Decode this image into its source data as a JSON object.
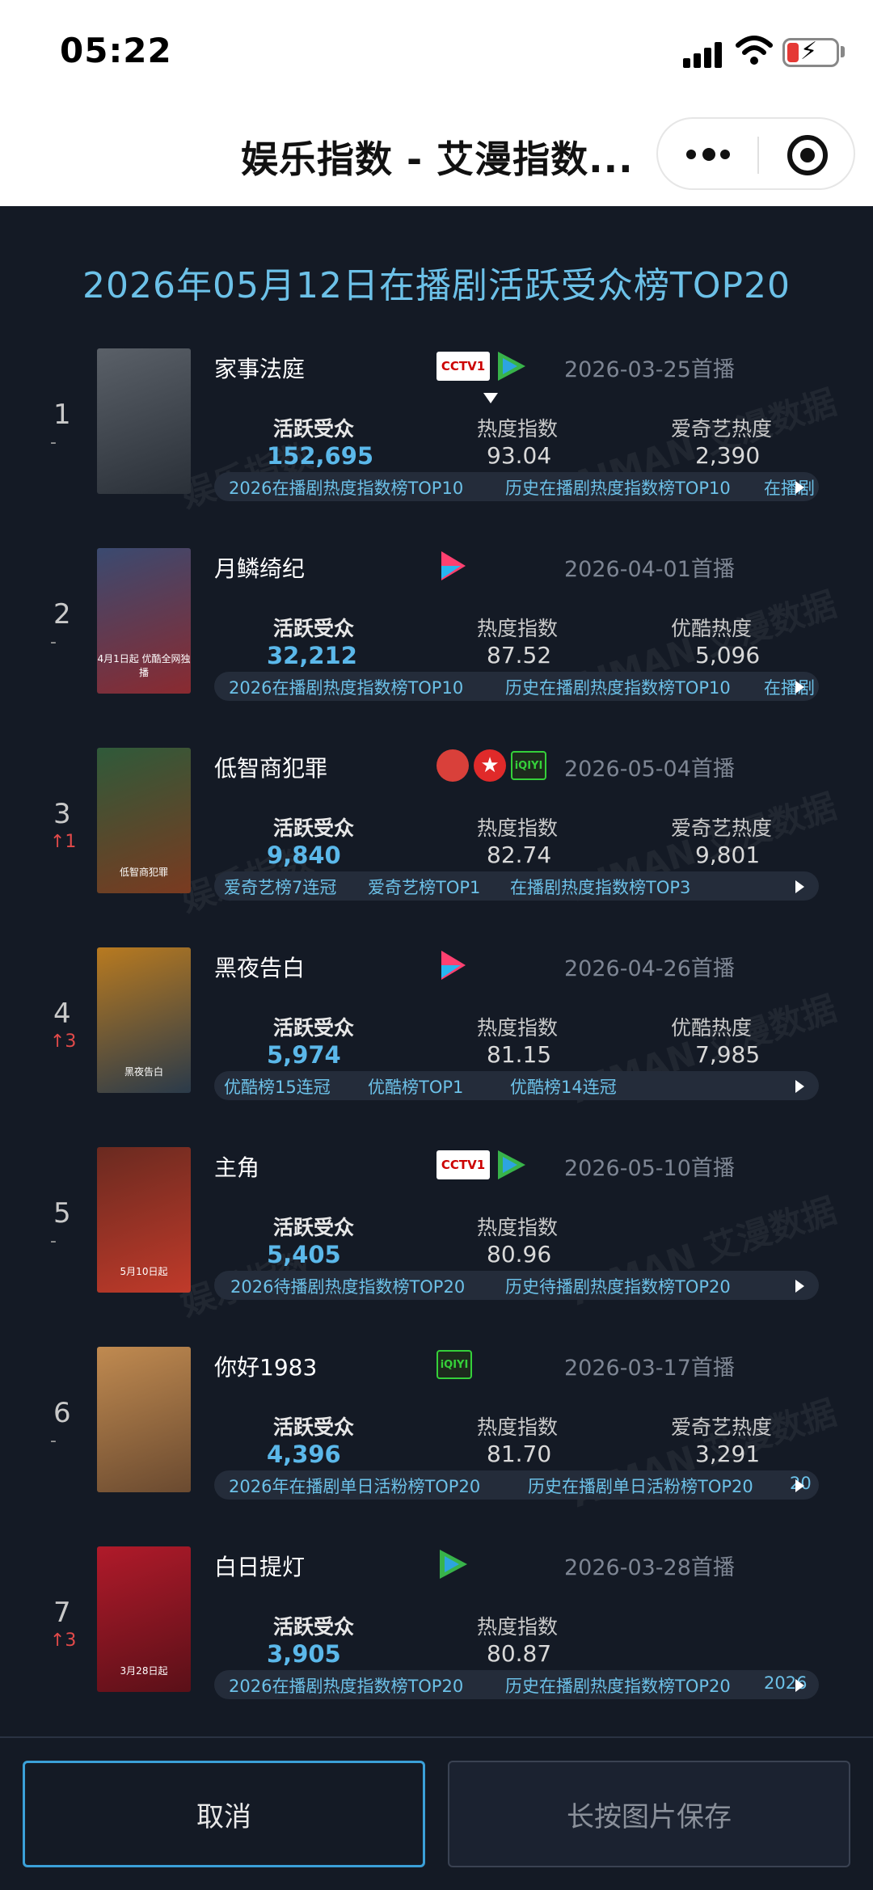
{
  "status_bar": {
    "time": "05:22"
  },
  "nav": {
    "title": "娱乐指数 - 艾漫指数..."
  },
  "chart_title": "2026年05月12日在播剧活跃受众榜TOP20",
  "watermarks": [
    "AIMAN 艾漫数据",
    "娱乐指数"
  ],
  "shows": [
    {
      "rank": "1",
      "change": "-",
      "name": "家事法庭",
      "platforms": [
        "cctv",
        "tencent"
      ],
      "premiere": "2026-03-25首播",
      "audience_label": "活跃受众",
      "audience": "152,695",
      "heat_label": "热度指数",
      "heat": "93.04",
      "platform_heat_label": "爱奇艺热度",
      "platform_heat": "2,390",
      "tags": [
        "2026在播剧热度指数榜TOP10",
        "历史在播剧热度指数榜TOP10",
        "在播剧"
      ],
      "poster_colors": [
        "#5a6068",
        "#2a3038"
      ]
    },
    {
      "rank": "2",
      "change": "-",
      "name": "月鳞绮纪",
      "platforms": [
        "youku"
      ],
      "premiere": "2026-04-01首播",
      "audience_label": "活跃受众",
      "audience": "32,212",
      "heat_label": "热度指数",
      "heat": "87.52",
      "platform_heat_label": "优酷热度",
      "platform_heat": "5,096",
      "tags": [
        "2026在播剧热度指数榜TOP10",
        "历史在播剧热度指数榜TOP10",
        "在播剧"
      ],
      "poster_colors": [
        "#3a4a70",
        "#8a2a30"
      ],
      "poster_text": "4月1日起 优酷全网独播"
    },
    {
      "rank": "3",
      "change": "↑1",
      "name": "低智商犯罪",
      "platforms": [
        "mango",
        "star",
        "iqiyi"
      ],
      "premiere": "2026-05-04首播",
      "audience_label": "活跃受众",
      "audience": "9,840",
      "heat_label": "热度指数",
      "heat": "82.74",
      "platform_heat_label": "爱奇艺热度",
      "platform_heat": "9,801",
      "tags": [
        "爱奇艺榜7连冠",
        "爱奇艺榜TOP1",
        "在播剧热度指数榜TOP3"
      ],
      "poster_colors": [
        "#2f5a3a",
        "#7a3a20"
      ],
      "poster_text": "低智商犯罪"
    },
    {
      "rank": "4",
      "change": "↑3",
      "name": "黑夜告白",
      "platforms": [
        "youku"
      ],
      "premiere": "2026-04-26首播",
      "audience_label": "活跃受众",
      "audience": "5,974",
      "heat_label": "热度指数",
      "heat": "81.15",
      "platform_heat_label": "优酷热度",
      "platform_heat": "7,985",
      "tags": [
        "优酷榜15连冠",
        "优酷榜TOP1",
        "优酷榜14连冠"
      ],
      "poster_colors": [
        "#b87a20",
        "#2a3a4a"
      ],
      "poster_text": "黑夜告白"
    },
    {
      "rank": "5",
      "change": "-",
      "name": "主角",
      "platforms": [
        "cctv",
        "tencent"
      ],
      "premiere": "2026-05-10首播",
      "audience_label": "活跃受众",
      "audience": "5,405",
      "heat_label": "热度指数",
      "heat": "80.96",
      "platform_heat_label": "",
      "platform_heat": "",
      "tags": [
        "2026待播剧热度指数榜TOP20",
        "历史待播剧热度指数榜TOP20"
      ],
      "poster_colors": [
        "#6a2a20",
        "#c03a2a"
      ],
      "poster_text": "5月10日起"
    },
    {
      "rank": "6",
      "change": "-",
      "name": "你好1983",
      "platforms": [
        "iqiyi"
      ],
      "premiere": "2026-03-17首播",
      "audience_label": "活跃受众",
      "audience": "4,396",
      "heat_label": "热度指数",
      "heat": "81.70",
      "platform_heat_label": "爱奇艺热度",
      "platform_heat": "3,291",
      "tags": [
        "2026年在播剧单日活粉榜TOP20",
        "历史在播剧单日活粉榜TOP20",
        "20"
      ],
      "poster_colors": [
        "#c08a50",
        "#6a4a30"
      ]
    },
    {
      "rank": "7",
      "change": "↑3",
      "name": "白日提灯",
      "platforms": [
        "tencent"
      ],
      "premiere": "2026-03-28首播",
      "audience_label": "活跃受众",
      "audience": "3,905",
      "heat_label": "热度指数",
      "heat": "80.87",
      "platform_heat_label": "",
      "platform_heat": "",
      "tags": [
        "2026在播剧热度指数榜TOP20",
        "历史在播剧热度指数榜TOP20",
        "2026"
      ],
      "poster_colors": [
        "#b01a2a",
        "#5a1018"
      ],
      "poster_text": "3月28日起"
    }
  ],
  "actions": {
    "cancel": "取消",
    "save_hint": "长按图片保存"
  },
  "colors": {
    "panel_bg": "#141a25",
    "accent": "#6cc1e8",
    "audience": "#5bb8ea",
    "rank_up": "#e24a4a"
  }
}
